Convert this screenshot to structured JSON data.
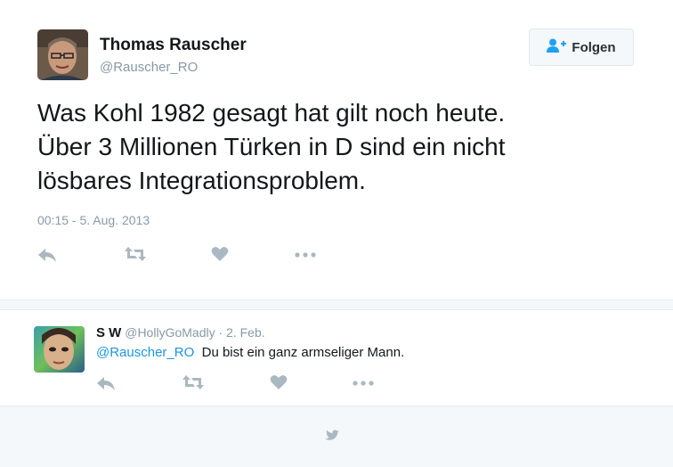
{
  "tweet": {
    "author_name": "Thomas Rauscher",
    "author_handle": "@Rauscher_RO",
    "text_lines": [
      "Was Kohl 1982 gesagt hat gilt noch heute.",
      "Über 3 Millionen Türken in D sind ein nicht",
      "lösbares Integrationsproblem."
    ],
    "timestamp": "00:15 - 5. Aug. 2013",
    "follow_label": "Folgen",
    "actions": [
      "reply-icon",
      "retweet-icon",
      "like-icon",
      "more-icon"
    ]
  },
  "reply": {
    "author_name": "S W",
    "author_handle": "@HollyGoMadly",
    "separator": " · ",
    "date": "2. Feb.",
    "mention": "@Rauscher_RO",
    "text": "Du bist ein ganz armseliger Mann.",
    "actions": [
      "reply-icon",
      "retweet-icon",
      "like-icon",
      "more-icon"
    ]
  },
  "footer": {
    "icon": "twitter-bird-icon"
  },
  "colors": {
    "text": "#14171a",
    "secondary": "#8899a6",
    "link": "#1b95e0",
    "icon": "#aab8c2",
    "follow_icon": "#1da1f2",
    "background_alt": "#f5f8fa"
  }
}
